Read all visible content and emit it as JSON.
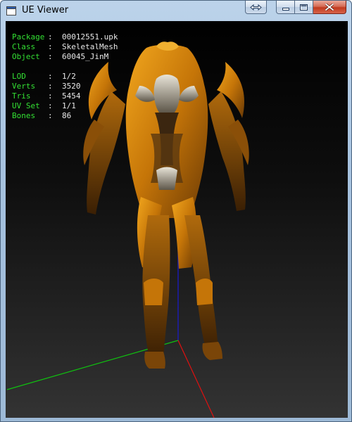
{
  "window": {
    "title": "UE Viewer",
    "buttons": [
      "snap-icon",
      "minimize-icon",
      "maximize-icon",
      "close-icon"
    ]
  },
  "info": {
    "asset": [
      {
        "key": "Package",
        "value": "00012551.upk"
      },
      {
        "key": "Class",
        "value": "SkeletalMesh"
      },
      {
        "key": "Object",
        "value": "60045_JinM"
      }
    ],
    "stats": [
      {
        "key": "LOD",
        "value": "1/2"
      },
      {
        "key": "Verts",
        "value": "3520"
      },
      {
        "key": "Tris",
        "value": "5454"
      },
      {
        "key": "UV Set",
        "value": "1/1"
      },
      {
        "key": "Bones",
        "value": "86"
      }
    ]
  },
  "colors": {
    "label": "#33e033",
    "value": "#e8e8e8",
    "axis_x": "#e01010",
    "axis_y": "#10c010",
    "axis_z": "#1a1ad0",
    "armor": "#d98a12"
  }
}
